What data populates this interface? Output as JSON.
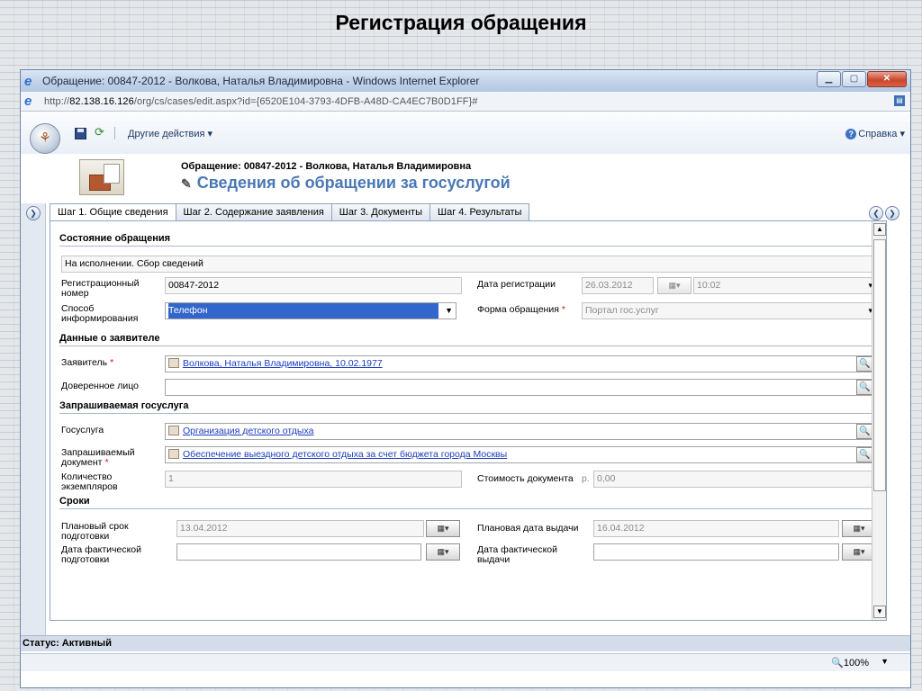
{
  "slide": {
    "title": "Регистрация обращения"
  },
  "window": {
    "title": "Обращение: 00847-2012 - Волкова, Наталья Владимировна - Windows Internet Explorer",
    "url_prefix": "http://",
    "url_host": "82.138.16.126",
    "url_path": "/org/cs/cases/edit.aspx?id={6520E104-3793-4DFB-A48D-CA4EC7B0D1FF}#"
  },
  "toolbar": {
    "more_actions": "Другие действия",
    "help": "Справка"
  },
  "header": {
    "title": "Обращение: 00847-2012 - Волкова, Наталья Владимировна",
    "subtitle": "Сведения об обращении за госуслугой"
  },
  "tabs": [
    {
      "label": "Шаг 1. Общие сведения"
    },
    {
      "label": "Шаг 2. Содержание заявления"
    },
    {
      "label": "Шаг 3. Документы"
    },
    {
      "label": "Шаг 4. Результаты"
    }
  ],
  "sections": {
    "state": "Состояние обращения",
    "applicant": "Данные о заявителе",
    "service": "Запрашиваемая госуслуга",
    "terms": "Сроки"
  },
  "form": {
    "status_value": "На исполнении. Сбор сведений",
    "reg_number_label": "Регистрационный номер",
    "reg_number_value": "00847-2012",
    "reg_date_label": "Дата регистрации",
    "reg_date_value": "26.03.2012",
    "reg_time_value": "10:02",
    "info_method_label": "Способ информирования",
    "info_method_value": "Телефон",
    "appeal_form_label": "Форма обращения",
    "appeal_form_value": "Портал гос.услуг",
    "applicant_label": "Заявитель",
    "applicant_value": "Волкова, Наталья Владимировна, 10.02.1977",
    "proxy_label": "Доверенное лицо",
    "service_label": "Госуслуга",
    "service_value": "Организация детского отдыха",
    "requested_doc_label": "Запрашиваемый документ",
    "requested_doc_value": "Обеспечение выездного детского отдыха за счет бюджета города Москвы",
    "copies_label": "Количество экземпляров",
    "copies_value": "1",
    "doc_cost_label": "Стоимость документа",
    "currency": "р.",
    "doc_cost_value": "0,00",
    "planned_prep_label": "Плановый срок подготовки",
    "planned_prep_value": "13.04.2012",
    "planned_issue_label": "Плановая дата выдачи",
    "planned_issue_value": "16.04.2012",
    "actual_prep_label": "Дата фактической подготовки",
    "actual_issue_label": "Дата фактической выдачи"
  },
  "status": {
    "text": "Статус: Активный"
  },
  "iestatus": {
    "zoom": "100%"
  }
}
